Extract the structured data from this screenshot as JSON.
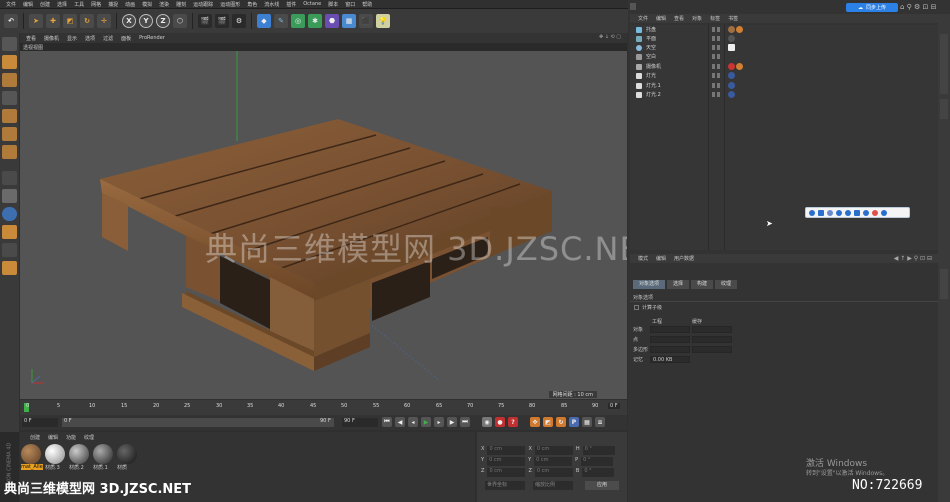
{
  "menubar": [
    "文件",
    "编辑",
    "创建",
    "选择",
    "工具",
    "网格",
    "捕捉",
    "动画",
    "模拟",
    "渲染",
    "雕刻",
    "运动跟踪",
    "运动图形",
    "角色",
    "流水线",
    "插件",
    "Octane",
    "脚本",
    "窗口",
    "帮助"
  ],
  "toolbar": {
    "axis_x": "X",
    "axis_y": "Y",
    "axis_z": "Z"
  },
  "viewport": {
    "menu": [
      "查看",
      "摄像机",
      "显示",
      "选项",
      "过滤",
      "面板",
      "ProRender"
    ],
    "title": "透视视图",
    "grid_status": "网格间距 : 10 cm"
  },
  "timeline": {
    "ticks": [
      "0",
      "5",
      "10",
      "15",
      "20",
      "25",
      "30",
      "35",
      "40",
      "45",
      "50",
      "55",
      "60",
      "65",
      "70",
      "75",
      "80",
      "85",
      "90"
    ],
    "frame_end": "0 F",
    "current_frame": "0 F",
    "start_field": "0 F",
    "end_field": "90 F",
    "end_field2": "90 F"
  },
  "material_panel": {
    "menu": [
      "创建",
      "编辑",
      "功能",
      "纹理"
    ],
    "materials": [
      "mat_Alle",
      "材质.3",
      "材质.2",
      "材质.1",
      "材质"
    ]
  },
  "coords": {
    "rows": [
      {
        "a": "X",
        "av": "0 cm",
        "b": "X",
        "bv": "0 cm",
        "c": "H",
        "cv": "0 °"
      },
      {
        "a": "Y",
        "av": "0 cm",
        "b": "Y",
        "bv": "0 cm",
        "c": "P",
        "cv": "0 °"
      },
      {
        "a": "Z",
        "av": "0 cm",
        "b": "Z",
        "bv": "0 cm",
        "c": "B",
        "cv": "0 °"
      }
    ],
    "mode1": "世界坐标",
    "mode2": "缩放比例",
    "apply": "应用"
  },
  "object_manager": {
    "menu": [
      "文件",
      "编辑",
      "查看",
      "对象",
      "标签",
      "书签"
    ],
    "objects": [
      "托盘",
      "平面",
      "天空",
      "空白",
      "摄像机",
      "灯光",
      "灯光.1",
      "灯光.2"
    ]
  },
  "cloud_button": "同步上传",
  "attributes": {
    "menu": [
      "模式",
      "编辑",
      "用户数据"
    ],
    "tabs": [
      "对象选项",
      "选择",
      "构建",
      "纹理"
    ],
    "section": "对象选项",
    "checkbox_label": "计算子级",
    "col1": "工程",
    "col2": "缓存",
    "labels": [
      "对象",
      "点",
      "多边形",
      "记忆"
    ],
    "memory_value": "0.00 KB"
  },
  "watermark": {
    "center": "典尚三维模型网 3D.JZSC.NET",
    "bottom": "典尚三维模型网 3D.JZSC.NET",
    "number": "NO:722669",
    "windows1": "激活 Windows",
    "windows2": "转到\"设置\"以激活 Windows。"
  },
  "brand": "MAXON CINEMA 4D"
}
